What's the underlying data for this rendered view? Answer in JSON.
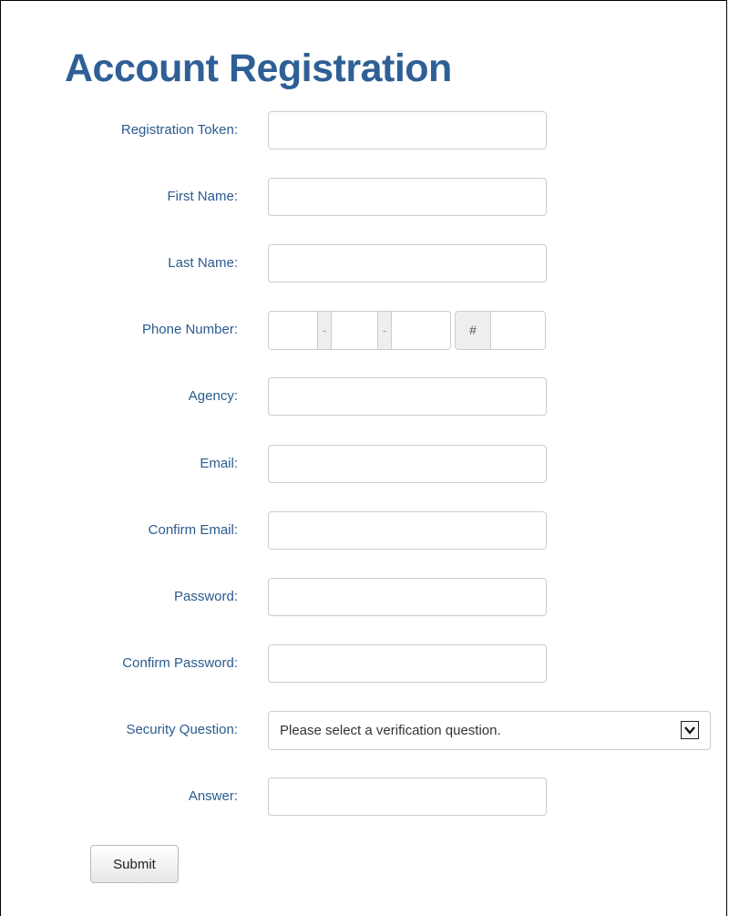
{
  "page": {
    "title": "Account Registration"
  },
  "form": {
    "registration_token": {
      "label": "Registration Token:",
      "value": ""
    },
    "first_name": {
      "label": "First Name:",
      "value": ""
    },
    "last_name": {
      "label": "Last Name:",
      "value": ""
    },
    "phone": {
      "label": "Phone Number:",
      "separator": "-",
      "ext_symbol": "#",
      "area": "",
      "prefix": "",
      "line": "",
      "ext": ""
    },
    "agency": {
      "label": "Agency:",
      "value": ""
    },
    "email": {
      "label": "Email:",
      "value": ""
    },
    "confirm_email": {
      "label": "Confirm Email:",
      "value": ""
    },
    "password": {
      "label": "Password:",
      "value": ""
    },
    "confirm_password": {
      "label": "Confirm Password:",
      "value": ""
    },
    "security_question": {
      "label": "Security Question:",
      "selected": "Please select a verification question."
    },
    "answer": {
      "label": "Answer:",
      "value": ""
    },
    "submit_label": "Submit"
  }
}
